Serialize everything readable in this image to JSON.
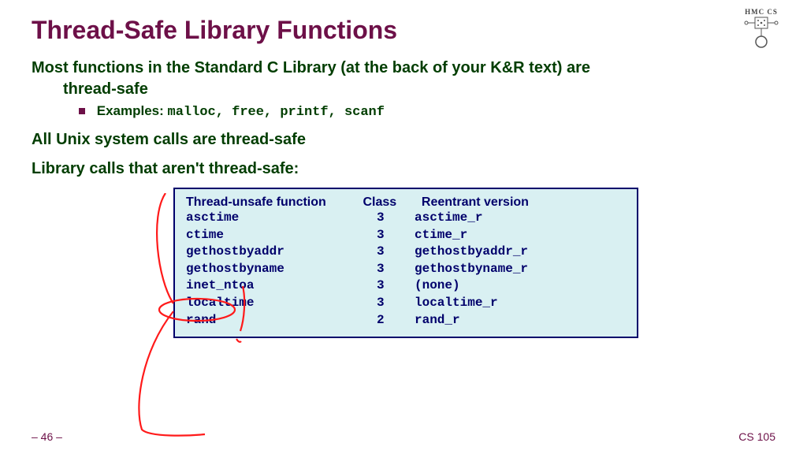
{
  "title": "Thread-Safe Library Functions",
  "p1a": "Most functions in the Standard C Library (at the back of your K&R text) are",
  "p1b": "thread-safe",
  "examples_label": "Examples:",
  "examples_list": "malloc, free, printf, scanf",
  "p2": "All Unix system calls are thread-safe",
  "p3": "Library calls that aren't thread-safe:",
  "table": {
    "headers": {
      "h1": "Thread-unsafe function",
      "h2": "Class",
      "h3": "Reentrant version"
    },
    "rows": [
      {
        "fn": "asctime",
        "cls": "3",
        "re": "asctime_r"
      },
      {
        "fn": "ctime",
        "cls": "3",
        "re": "ctime_r"
      },
      {
        "fn": "gethostbyaddr",
        "cls": "3",
        "re": "gethostbyaddr_r"
      },
      {
        "fn": "gethostbyname",
        "cls": "3",
        "re": "gethostbyname_r"
      },
      {
        "fn": "inet_ntoa",
        "cls": "3",
        "re": "(none)"
      },
      {
        "fn": "localtime",
        "cls": "3",
        "re": "localtime_r"
      },
      {
        "fn": "rand",
        "cls": "2",
        "re": "rand_r"
      }
    ]
  },
  "footer": {
    "page": "– 46 –",
    "course": "CS 105"
  },
  "logo_text": "HMC CS"
}
